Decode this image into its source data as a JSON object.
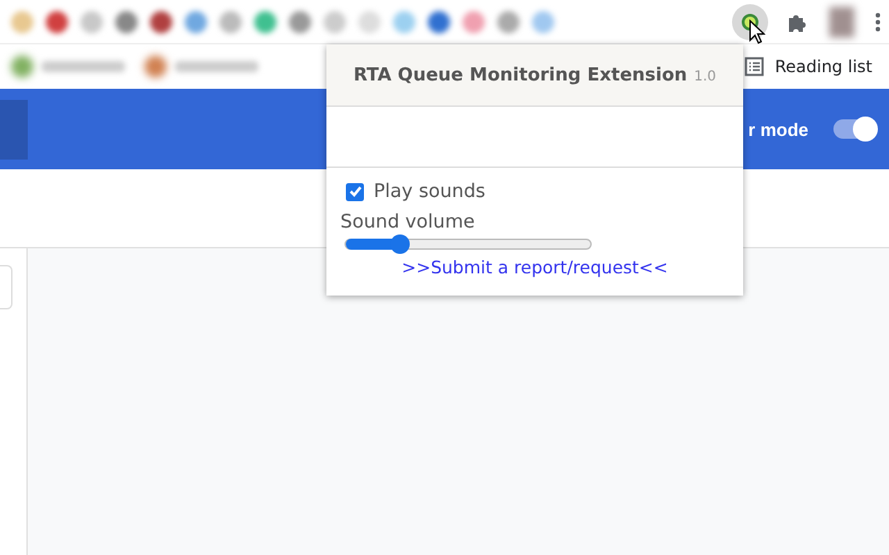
{
  "bookmarks_bar": {
    "reading_list": "Reading list"
  },
  "header": {
    "mode_label": "r mode",
    "mode_toggle": {
      "on": true
    }
  },
  "popup": {
    "title": "RTA Queue Monitoring Extension",
    "version": "1.0",
    "play_sounds": {
      "label": "Play sounds",
      "checked": true
    },
    "volume": {
      "label": "Sound volume",
      "level": 0.22
    },
    "report_link": ">>Submit a report/request<<"
  }
}
